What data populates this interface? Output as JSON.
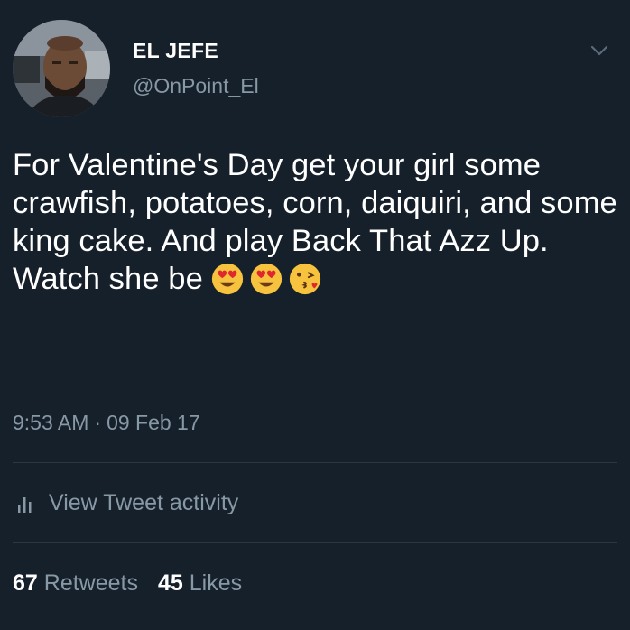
{
  "author": {
    "display_name": "EL JEFE",
    "handle": "@OnPoint_El",
    "avatar_icon": "profile-photo"
  },
  "menu": {
    "icon": "chevron-down-icon"
  },
  "tweet": {
    "text": "For Valentine's Day get your girl some crawfish, potatoes, corn, daiquiri, and some king cake. And play Back That Azz Up. Watch she be",
    "emojis": [
      "smiling-face-with-heart-eyes",
      "smiling-face-with-heart-eyes",
      "face-blowing-a-kiss"
    ]
  },
  "timestamp": {
    "time": "9:53 AM",
    "separator": "·",
    "date": "09 Feb 17"
  },
  "activity": {
    "icon": "bar-chart-icon",
    "label": "View Tweet activity"
  },
  "stats": {
    "retweets_count": "67",
    "retweets_label": "Retweets",
    "likes_count": "45",
    "likes_label": "Likes"
  },
  "colors": {
    "background": "#16202b",
    "primary_text": "#ffffff",
    "secondary_text": "#8899a6",
    "divider": "#2b3742"
  }
}
